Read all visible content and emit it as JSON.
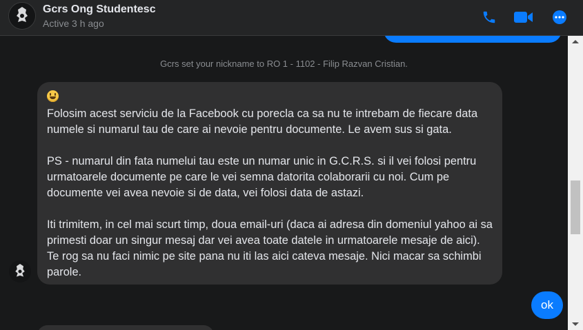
{
  "header": {
    "title": "Gcrs Ong Studentesc",
    "status": "Active 3 h ago",
    "icons": [
      "phone-icon",
      "video-icon",
      "more-icon"
    ],
    "accent": "#0a7cff"
  },
  "messages": {
    "nickname_notice": "Gcrs set your nickname to RO 1 - 1102 - Filip Razvan Cristian.",
    "long_message": {
      "emoji": "grinning-face",
      "paragraphs": [
        "Folosim acest serviciu de la Facebook cu porecla ca sa nu te intrebam de fiecare data numele si numarul tau de care ai nevoie pentru documente. Le avem sus si gata.",
        "PS - numarul din fata numelui tau este un numar unic in G.C.R.S. si il vei folosi pentru urmatoarele documente pe care le vei semna datorita colaborarii cu noi. Cum pe documente vei avea nevoie si de data, vei folosi data de astazi.",
        "Iti trimitem, in cel mai scurt timp, doua email-uri (daca ai adresa din domeniul yahoo ai sa primesti doar un singur mesaj dar vei avea toate datele in urmatoarele mesaje de aici). Te rog sa nu faci nimic pe site pana nu iti las aici cateva mesaje. Nici macar sa schimbi parole."
      ]
    },
    "reply": "ok"
  },
  "colors": {
    "background": "#18191a",
    "bubble_received": "#303031",
    "bubble_sent": "#0a7cff"
  }
}
